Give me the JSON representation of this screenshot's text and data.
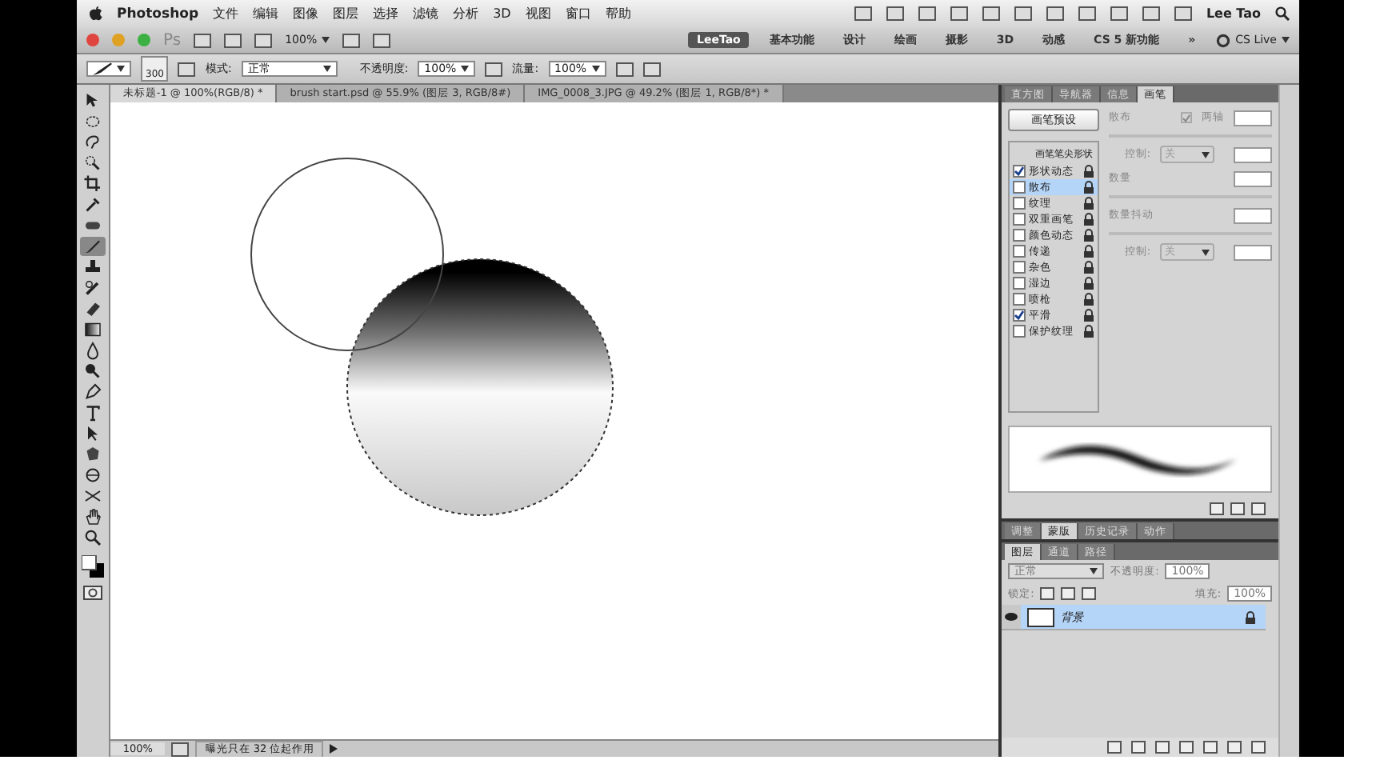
{
  "menu_bar": {
    "app_name": "Photoshop",
    "menus": [
      "文件",
      "编辑",
      "图像",
      "图层",
      "选择",
      "滤镜",
      "分析",
      "3D",
      "视图",
      "窗口",
      "帮助"
    ],
    "user": "Lee Tao"
  },
  "app_bar": {
    "logo": "Ps",
    "zoom": "100%",
    "workspaces": [
      {
        "label": "LeeTao",
        "selected": true
      },
      {
        "label": "基本功能",
        "selected": false
      },
      {
        "label": "设计",
        "selected": false
      },
      {
        "label": "绘画",
        "selected": false
      },
      {
        "label": "摄影",
        "selected": false
      },
      {
        "label": "3D",
        "selected": false
      },
      {
        "label": "动感",
        "selected": false
      },
      {
        "label": "CS 5 新功能",
        "selected": false
      }
    ],
    "more": "»",
    "cs_live": "CS Live"
  },
  "options_bar": {
    "brush_size": "300",
    "mode_label": "模式:",
    "mode": "正常",
    "opacity_label": "不透明度:",
    "opacity": "100%",
    "flow_label": "流量:",
    "flow": "100%"
  },
  "document_tabs": [
    {
      "title": "未标题-1 @ 100%(RGB/8) *",
      "selected": true
    },
    {
      "title": "brush start.psd @ 55.9% (图层 3, RGB/8#)",
      "selected": false
    },
    {
      "title": "IMG_0008_3.JPG @ 49.2% (图层 1, RGB/8*) *",
      "selected": false
    }
  ],
  "tools": [
    {
      "kind": "move",
      "selected": false
    },
    {
      "kind": "marquee",
      "selected": false
    },
    {
      "kind": "lasso",
      "selected": false
    },
    {
      "kind": "quick-select",
      "selected": false
    },
    {
      "kind": "crop",
      "selected": false
    },
    {
      "kind": "eyedropper",
      "selected": false
    },
    {
      "kind": "healing",
      "selected": false
    },
    {
      "kind": "brush",
      "selected": true
    },
    {
      "kind": "stamp",
      "selected": false
    },
    {
      "kind": "history-brush",
      "selected": false
    },
    {
      "kind": "eraser",
      "selected": false
    },
    {
      "kind": "gradient",
      "selected": false
    },
    {
      "kind": "blur",
      "selected": false
    },
    {
      "kind": "dodge",
      "selected": false
    },
    {
      "kind": "pen",
      "selected": false
    },
    {
      "kind": "type",
      "selected": false
    },
    {
      "kind": "path-select",
      "selected": false
    },
    {
      "kind": "shape",
      "selected": false
    },
    {
      "kind": "rotate-3d",
      "selected": false
    },
    {
      "kind": "camera-3d",
      "selected": false
    },
    {
      "kind": "hand",
      "selected": false
    },
    {
      "kind": "zoom",
      "selected": false
    }
  ],
  "status_bar": {
    "zoom": "100%",
    "message": "曝光只在 32 位起作用"
  },
  "brush_panel": {
    "tabs": [
      {
        "label": "直方图",
        "selected": false
      },
      {
        "label": "导航器",
        "selected": false
      },
      {
        "label": "信息",
        "selected": false
      },
      {
        "label": "画笔",
        "selected": true
      }
    ],
    "presets_button": "画笔预设",
    "tip_shape": "画笔笔尖形状",
    "options": [
      {
        "label": "形状动态",
        "checked": true,
        "selected": false
      },
      {
        "label": "散布",
        "checked": false,
        "selected": true
      },
      {
        "label": "纹理",
        "checked": false,
        "selected": false
      },
      {
        "label": "双重画笔",
        "checked": false,
        "selected": false
      },
      {
        "label": "颜色动态",
        "checked": false,
        "selected": false
      },
      {
        "label": "传递",
        "checked": false,
        "selected": false
      },
      {
        "label": "杂色",
        "checked": false,
        "selected": false
      },
      {
        "label": "湿边",
        "checked": false,
        "selected": false
      },
      {
        "label": "喷枪",
        "checked": false,
        "selected": false
      },
      {
        "label": "平滑",
        "checked": true,
        "selected": false
      },
      {
        "label": "保护纹理",
        "checked": false,
        "selected": false
      }
    ],
    "scatter_label": "散布",
    "both_axes": {
      "label": "两轴",
      "checked": true
    },
    "control_label": "控制:",
    "control_value": "关",
    "count_label": "数量",
    "count_jitter_label": "数量抖动",
    "control2_label": "控制:",
    "control2_value": "关"
  },
  "mid_tabs": [
    {
      "label": "调整",
      "selected": false
    },
    {
      "label": "蒙版",
      "selected": true
    },
    {
      "label": "历史记录",
      "selected": false
    },
    {
      "label": "动作",
      "selected": false
    }
  ],
  "layers_panel": {
    "tabs": [
      {
        "label": "图层",
        "selected": true
      },
      {
        "label": "通道",
        "selected": false
      },
      {
        "label": "路径",
        "selected": false
      }
    ],
    "blend_mode": "正常",
    "opacity_label": "不透明度:",
    "opacity": "100%",
    "lock_label": "锁定:",
    "fill_label": "填充:",
    "fill": "100%",
    "layers": [
      {
        "name": "背景",
        "selected": true,
        "visible": true,
        "locked": true
      }
    ]
  }
}
